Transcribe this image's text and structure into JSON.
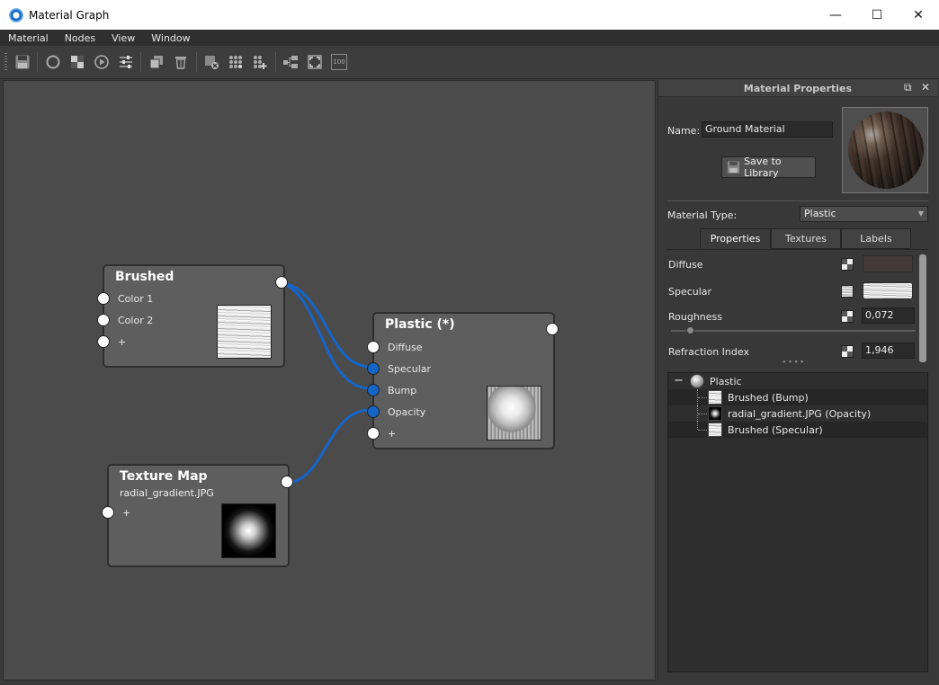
{
  "window": {
    "title": "Material Graph",
    "minimize": "—",
    "maximize": "☐",
    "close": "✕"
  },
  "menu": {
    "items": [
      "Material",
      "Nodes",
      "View",
      "Window"
    ]
  },
  "toolbar": {
    "icons": [
      "save-icon",
      "new-sphere-icon",
      "checker-icon",
      "play-icon",
      "sliders-icon",
      "duplicate-icon",
      "delete-icon",
      "remove-node-icon",
      "grid-nodes-icon",
      "grid-add-icon",
      "arrange-icon",
      "fit-view-icon",
      "zoom-100-icon"
    ],
    "zoom_label": "100"
  },
  "graph": {
    "nodes": {
      "brushed": {
        "title": "Brushed",
        "ports": [
          "Color 1",
          "Color 2",
          "+"
        ]
      },
      "plastic": {
        "title": "Plastic (*)",
        "ports": [
          "Diffuse",
          "Specular",
          "Bump",
          "Opacity",
          "+"
        ]
      },
      "texture_map": {
        "title": "Texture Map",
        "subtitle": "radial_gradient.JPG",
        "ports": [
          "+"
        ]
      }
    },
    "colors": {
      "wire": "#1565c8",
      "port_connected": "#1565c8",
      "port_free": "#ffffff"
    }
  },
  "panel": {
    "title": "Material Properties",
    "float_icon": "⧉",
    "close_icon": "✕",
    "name_label": "Name:",
    "name_value": "Ground Material",
    "save_to_library": "Save to Library",
    "material_type_label": "Material Type:",
    "material_type_value": "Plastic",
    "tabs": [
      "Properties",
      "Textures",
      "Labels"
    ],
    "active_tab": "Properties",
    "properties": {
      "diffuse": {
        "label": "Diffuse",
        "color": "#433a36"
      },
      "specular": {
        "label": "Specular"
      },
      "roughness": {
        "label": "Roughness",
        "value": "0,072"
      },
      "refraction": {
        "label": "Refraction Index",
        "value": "1,946"
      }
    },
    "tree": {
      "root": {
        "collapse": "−",
        "label": "Plastic"
      },
      "children": [
        "Brushed (Bump)",
        "radial_gradient.JPG (Opacity)",
        "Brushed (Specular)"
      ]
    }
  }
}
